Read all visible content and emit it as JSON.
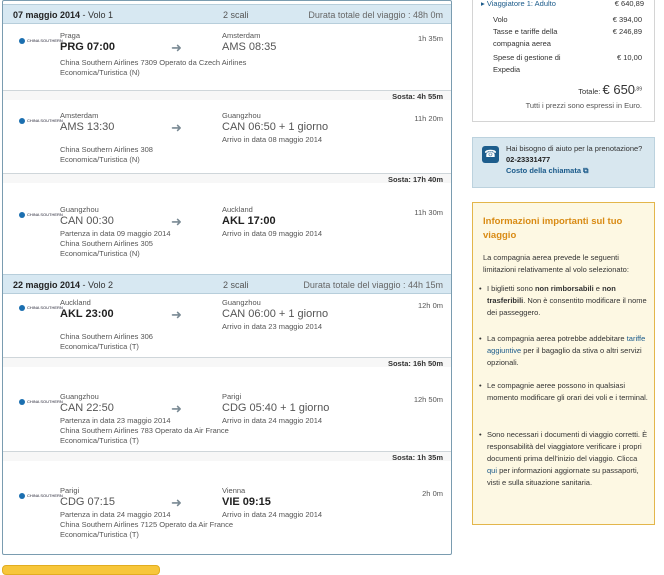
{
  "legs": [
    {
      "date": "07 maggio 2014",
      "label": " - Volo 1",
      "stops": "2 scali",
      "duration": "Durata totale del viaggio : 48h 0m"
    },
    {
      "date": "22 maggio 2014",
      "label": " - Volo 2",
      "stops": "2 scali",
      "duration": "Durata totale del viaggio : 44h 15m"
    }
  ],
  "airline_logo": "CHINA SOUTHERN",
  "segments": [
    {
      "dep_city": "Praga",
      "dep": "PRG 07:00",
      "dep_bold": true,
      "arr_city": "Amsterdam",
      "arr": "AMS 08:35",
      "arr_bold": false,
      "dur": "1h 35m",
      "dep_note": "",
      "arr_note": "",
      "airline": "China Southern Airlines 7309 Operato da Czech Airlines",
      "cabin": "Economica/Turistica (N)",
      "layover": "Sosta:  4h 55m"
    },
    {
      "dep_city": "Amsterdam",
      "dep": "AMS 13:30",
      "dep_bold": false,
      "arr_city": "Guangzhou",
      "arr": "CAN 06:50 + 1 giorno",
      "arr_bold": false,
      "dur": "11h 20m",
      "dep_note": "",
      "arr_note": "Arrivo in data 08 maggio 2014",
      "airline": "China Southern Airlines 308",
      "cabin": "Economica/Turistica (N)",
      "layover": "Sosta:  17h 40m"
    },
    {
      "dep_city": "Guangzhou",
      "dep": "CAN 00:30",
      "dep_bold": false,
      "arr_city": "Auckland",
      "arr": "AKL 17:00",
      "arr_bold": true,
      "dur": "11h 30m",
      "dep_note": "Partenza in data 09 maggio 2014",
      "arr_note": "Arrivo in data 09 maggio 2014",
      "airline": "China Southern Airlines 305",
      "cabin": "Economica/Turistica (N)",
      "layover": ""
    },
    {
      "dep_city": "Auckland",
      "dep": "AKL 23:00",
      "dep_bold": true,
      "arr_city": "Guangzhou",
      "arr": "CAN 06:00 + 1 giorno",
      "arr_bold": false,
      "dur": "12h 0m",
      "dep_note": "",
      "arr_note": "Arrivo in data 23 maggio 2014",
      "airline": "China Southern Airlines 306",
      "cabin": "Economica/Turistica (T)",
      "layover": "Sosta:  16h 50m"
    },
    {
      "dep_city": "Guangzhou",
      "dep": "CAN 22:50",
      "dep_bold": false,
      "arr_city": "Parigi",
      "arr": "CDG 05:40 + 1 giorno",
      "arr_bold": false,
      "dur": "12h 50m",
      "dep_note": "Partenza in data 23 maggio 2014",
      "arr_note": "Arrivo in data 24 maggio 2014",
      "airline": "China Southern Airlines 783 Operato da Air France",
      "cabin": "Economica/Turistica (T)",
      "layover": "Sosta:  1h 35m"
    },
    {
      "dep_city": "Parigi",
      "dep": "CDG 07:15",
      "dep_bold": false,
      "arr_city": "Vienna",
      "arr": "VIE 09:15",
      "arr_bold": true,
      "dur": "2h 0m",
      "dep_note": "Partenza in data 24 maggio 2014",
      "arr_note": "Arrivo in data 24 maggio 2014",
      "airline": "China Southern Airlines 7125 Operato da Air France",
      "cabin": "Economica/Turistica (T)",
      "layover": ""
    }
  ],
  "price": {
    "traveler": "Viaggiatore 1: Adulto",
    "traveler_total": "€ 640,89",
    "rows": [
      {
        "label": "Volo",
        "value": "€ 394,00"
      },
      {
        "label": "Tasse e tariffe della",
        "value": "€ 246,89"
      },
      {
        "label": "compagnia aerea",
        "value": ""
      },
      {
        "label": "Spese di gestione di",
        "value": "€ 10,00"
      },
      {
        "label": "Expedia",
        "value": ""
      }
    ],
    "total_label": "Totale:",
    "total_value": "€ 650",
    "total_cents": ",89",
    "note": "Tutti i prezzi sono espressi in Euro."
  },
  "help": {
    "line1": "Hai bisogno di aiuto per la prenotazione?",
    "phone": "02-23331477",
    "link": "Costo della chiamata"
  },
  "info": {
    "title": "Informazioni importanti sul tuo viaggio",
    "intro": "La compagnia aerea prevede le seguenti limitazioni relativamente al volo selezionato:",
    "b1a": "I biglietti sono ",
    "b1b": "non rimborsabili",
    "b1c": " e ",
    "b1d": "non trasferibili",
    "b1e": ". Non è consentito modificare il nome dei passeggero.",
    "b2a": "La compagnia aerea potrebbe addebitare ",
    "b2b": "tariffe aggiuntive",
    "b2c": " per il bagaglio da stiva o altri servizi opzionali.",
    "b3": "Le compagnie aeree possono in qualsiasi momento modificare gli orari dei voli e i terminal.",
    "b4a": "Sono necessari i documenti di viaggio corretti. È responsabilità del viaggiatore verificare i propri documenti prima dell'inizio del viaggio. Clicca ",
    "b4b": "qui",
    "b4c": " per informazioni aggiornate su passaporti, visti e sulla situazione sanitaria."
  }
}
